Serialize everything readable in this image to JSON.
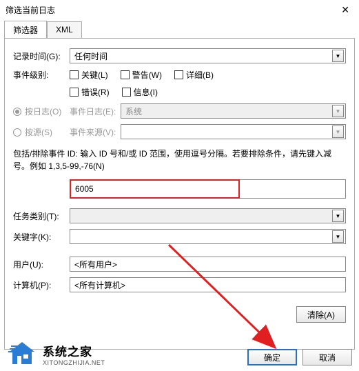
{
  "title": "筛选当前日志",
  "tabs": {
    "filter": "筛选器",
    "xml": "XML"
  },
  "labels": {
    "logged": "记录时间(G):",
    "eventLevel": "事件级别:",
    "byLog": "按日志(O)",
    "bySource": "按源(S)",
    "eventLog": "事件日志(E):",
    "eventSource": "事件来源(V):",
    "helpText": "包括/排除事件 ID: 输入 ID 号和/或 ID 范围，使用逗号分隔。若要排除条件，请先键入减号。例如 1,3,5-99,-76(N)",
    "taskCategory": "任务类别(T):",
    "keywords": "关键字(K):",
    "user": "用户(U):",
    "computer": "计算机(P):",
    "clear": "清除(A)",
    "ok": "确定",
    "cancel": "取消"
  },
  "values": {
    "loggedTime": "任何时间",
    "eventLogValue": "系统",
    "eventId": "6005",
    "user": "<所有用户>",
    "computer": "<所有计算机>"
  },
  "checkboxes": {
    "critical": "关键(L)",
    "warning": "警告(W)",
    "verbose": "详细(B)",
    "error": "错误(R)",
    "info": "信息(I)"
  },
  "logo": {
    "zh": "系统之家",
    "en": "XITONGZHIJIA.NET"
  }
}
